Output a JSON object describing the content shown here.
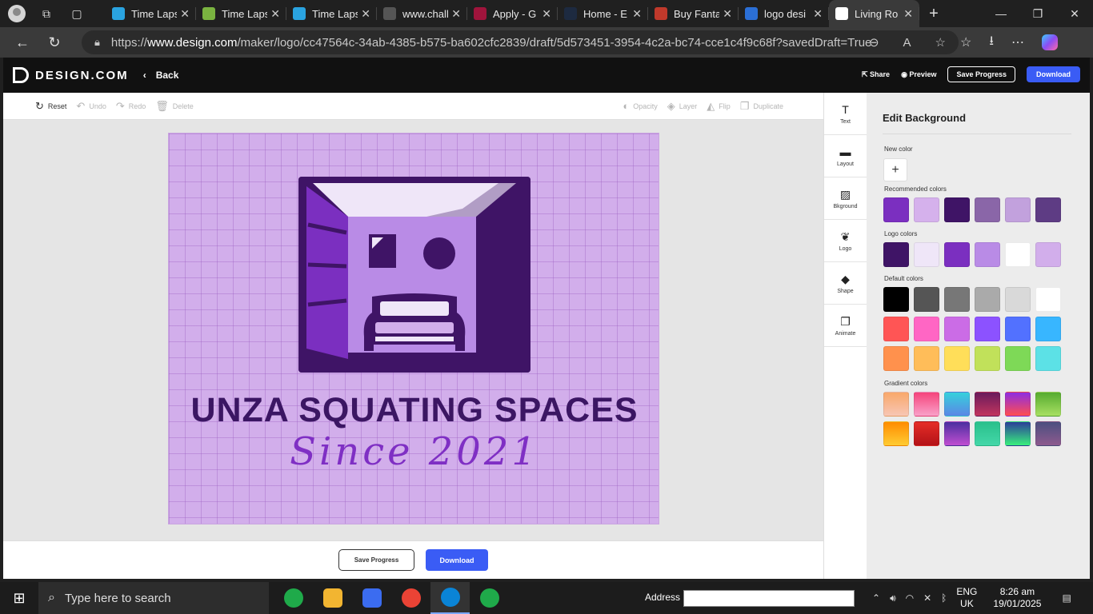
{
  "browser": {
    "tabs": [
      {
        "title": "Time Lapse",
        "fav": "#2aa3e0"
      },
      {
        "title": "Time Lapse",
        "fav": "#7ab340"
      },
      {
        "title": "Time Lapse",
        "fav": "#2aa3e0"
      },
      {
        "title": "www.chall",
        "fav": "#555555"
      },
      {
        "title": "Apply - G",
        "fav": "#a0143c"
      },
      {
        "title": "Home - E",
        "fav": "#1d2a40"
      },
      {
        "title": "Buy Fanta",
        "fav": "#c0392b"
      },
      {
        "title": "logo desi",
        "fav": "#2b6fd6"
      },
      {
        "title": "Living Ro",
        "fav": "#ffffff"
      }
    ],
    "url_prefix": "https://",
    "url_domain": "www.design.com",
    "url_rest": "/maker/logo/cc47564c-34ab-4385-b575-ba602cfc2839/draft/5d573451-3954-4c2a-bc74-cce1c4f9c68f?savedDraft=True"
  },
  "header": {
    "brand": "DESIGN.COM",
    "back": "Back",
    "share": "Share",
    "preview": "Preview",
    "save": "Save Progress",
    "download": "Download"
  },
  "toolbar": {
    "reset": "Reset",
    "undo": "Undo",
    "redo": "Redo",
    "delete": "Delete",
    "opacity": "Opacity",
    "layer": "Layer",
    "flip": "Flip",
    "duplicate": "Duplicate"
  },
  "canvas": {
    "title": "UNZA SQUATING SPACES",
    "subtitle": "Since 2021",
    "bg_color": "#d2aeeb"
  },
  "bottom": {
    "save": "Save Progress",
    "download": "Download"
  },
  "side_tools": [
    {
      "label": "Text",
      "icon": "text-icon",
      "glyph": "T"
    },
    {
      "label": "Layout",
      "icon": "layout-icon",
      "glyph": "▬"
    },
    {
      "label": "Bkground",
      "icon": "background-icon",
      "glyph": "▨"
    },
    {
      "label": "Logo",
      "icon": "logo-icon",
      "glyph": "❦"
    },
    {
      "label": "Shape",
      "icon": "shape-icon",
      "glyph": "◆"
    },
    {
      "label": "Animate",
      "icon": "animate-icon",
      "glyph": "❐"
    }
  ],
  "panel": {
    "title": "Edit Background",
    "new_color": "New color",
    "recommended": "Recommended colors",
    "logo_colors": "Logo colors",
    "default_colors": "Default colors",
    "gradient_colors": "Gradient colors",
    "recommended_swatches": [
      "#7b2fc0",
      "#d5b1ec",
      "#3f1466",
      "#8a66a8",
      "#c2a1dd",
      "#5e3c84"
    ],
    "logo_swatches": [
      "#3f1466",
      "#efe6f8",
      "#7b2fc0",
      "#b98be6",
      "#ffffff",
      "#d2aeeb"
    ],
    "default_swatches": [
      [
        "#000000",
        "#555555",
        "#777777",
        "#aaaaaa",
        "#d9d9d9",
        "#ffffff"
      ],
      [
        "#ff5555",
        "#ff66c4",
        "#cb6ce6",
        "#8c52ff",
        "#5271ff",
        "#38b6ff"
      ],
      [
        "#ff914d",
        "#ffbd59",
        "#ffde59",
        "#c1e15a",
        "#7ed957",
        "#5ce1e6"
      ]
    ],
    "gradient_swatches": [
      [
        "linear-gradient(180deg,#f9a86a,#f7c6b5)",
        "linear-gradient(180deg,#f5447c,#f9a1c9)",
        "linear-gradient(180deg,#36d1dc,#5b86e5)",
        "linear-gradient(180deg,#6a1b5c,#c2355e)",
        "linear-gradient(180deg,#8e2de2,#ff4e50)",
        "linear-gradient(180deg,#56ab2f,#a8e063)"
      ],
      [
        "linear-gradient(180deg,#ff8c00,#ffcc33)",
        "linear-gradient(180deg,#e52d27,#b31217)",
        "linear-gradient(180deg,#4b2fa0,#c04ed1)",
        "linear-gradient(180deg,#29c08b,#44d7a8)",
        "linear-gradient(180deg,#2c3e9a,#38ef7d)",
        "linear-gradient(180deg,#4b4f80,#8e5a8e)"
      ]
    ]
  },
  "taskbar": {
    "search_placeholder": "Type here to search",
    "address_label": "Address",
    "lang1": "ENG",
    "lang2": "UK",
    "time": "8:26 am",
    "date": "19/01/2025",
    "apps": [
      "#1faa4a",
      "#f2b531",
      "#3b6cf0",
      "#ea4335",
      "#0a84d6",
      "#1faa4a"
    ]
  }
}
